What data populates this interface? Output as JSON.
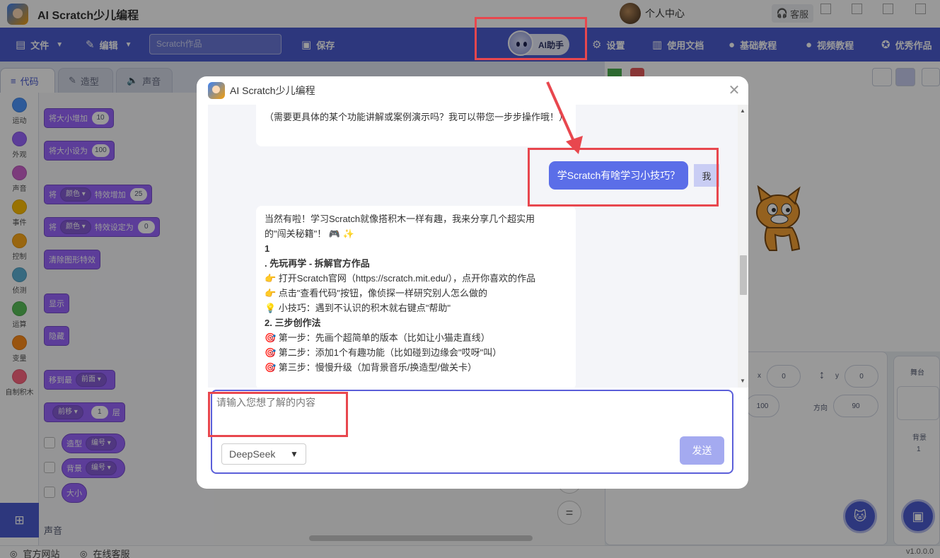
{
  "app": {
    "title": "AI Scratch少儿编程",
    "user_name": "个人中心",
    "service_label": "客服",
    "version": "v1.0.0.0"
  },
  "menubar": {
    "file": "文件",
    "edit": "编辑",
    "project_placeholder": "Scratch作品",
    "save": "保存",
    "ai_assistant": "AI助手",
    "settings": "设置",
    "docs": "使用文档",
    "basic_tutorial": "基础教程",
    "video_tutorial": "视频教程",
    "showcase": "优秀作品"
  },
  "tabs": [
    "代码",
    "造型",
    "声音"
  ],
  "categories": [
    {
      "label": "运动",
      "color": "#4c97ff"
    },
    {
      "label": "外观",
      "color": "#9966ff"
    },
    {
      "label": "声音",
      "color": "#cf63cf"
    },
    {
      "label": "事件",
      "color": "#ffbf00"
    },
    {
      "label": "控制",
      "color": "#ffab19"
    },
    {
      "label": "侦测",
      "color": "#5cb1d6"
    },
    {
      "label": "运算",
      "color": "#59c059"
    },
    {
      "label": "变量",
      "color": "#ff8c1a"
    },
    {
      "label": "自制积木",
      "color": "#ff6680"
    }
  ],
  "blocks": {
    "change_size": "将大小增加",
    "change_size_val": "10",
    "set_size": "将大小设为",
    "set_size_val": "100",
    "jiang": "将",
    "color_dd": "颜色",
    "effect_change": "特效增加",
    "effect_change_val": "25",
    "effect_set": "特效设定为",
    "effect_set_val": "0",
    "clear_effects": "清除图形特效",
    "show": "显示",
    "hide": "隐藏",
    "go_to": "移到最",
    "front_dd": "前面",
    "forward_dd": "前移",
    "layer_val": "1",
    "layer_label": "层",
    "costume": "造型",
    "number_dd": "编号",
    "backdrop": "背景",
    "size": "大小",
    "section_sound": "声音"
  },
  "sprite_info": {
    "x_label": "x",
    "x_val": "0",
    "y_label": "y",
    "y_val": "0",
    "size_val": "100",
    "direction_label": "方向",
    "direction_val": "90"
  },
  "stage_panel": {
    "title": "舞台",
    "backdrops_label": "背景",
    "backdrops_count": "1"
  },
  "footer": {
    "official_site": "官方网站",
    "online_service": "在线客服"
  },
  "dialog": {
    "title": "AI Scratch少儿编程",
    "prev_message_tail": "（需要更具体的某个功能讲解或案例演示吗？我可以带您一步步操作哦！）",
    "user_message": "学Scratch有啥学习小技巧？",
    "user_tag": "我",
    "reply_lines": [
      "当然有啦！学习Scratch就像搭积木一样有趣，我来分享几个超实用",
      "的\"闯关秘籍\"！ 🎮 ✨",
      "1",
      ". 先玩再学 - 拆解官方作品",
      "👉 打开Scratch官网（https://scratch.mit.edu/），点开你喜欢的作品",
      "👉 点击\"查看代码\"按钮，像侦探一样研究别人怎么做的",
      "💡 小技巧：遇到不认识的积木就右键点\"帮助\"",
      "2. 三步创作法",
      "🎯 第一步：先画个超简单的版本（比如让小猫走直线）",
      "🎯 第二步：添加1个有趣功能（比如碰到边缘会\"哎呀\"叫）",
      "🎯 第三步：慢慢升级（加背景音乐/换造型/做关卡）"
    ],
    "input_placeholder": "请输入您想了解的内容",
    "model": "DeepSeek",
    "send": "发送"
  },
  "colors": {
    "brand": "#4c5cd1",
    "highlight": "#e8474e",
    "user_bubble": "#5b6ee8",
    "send_disabled": "#a4aaf0"
  }
}
